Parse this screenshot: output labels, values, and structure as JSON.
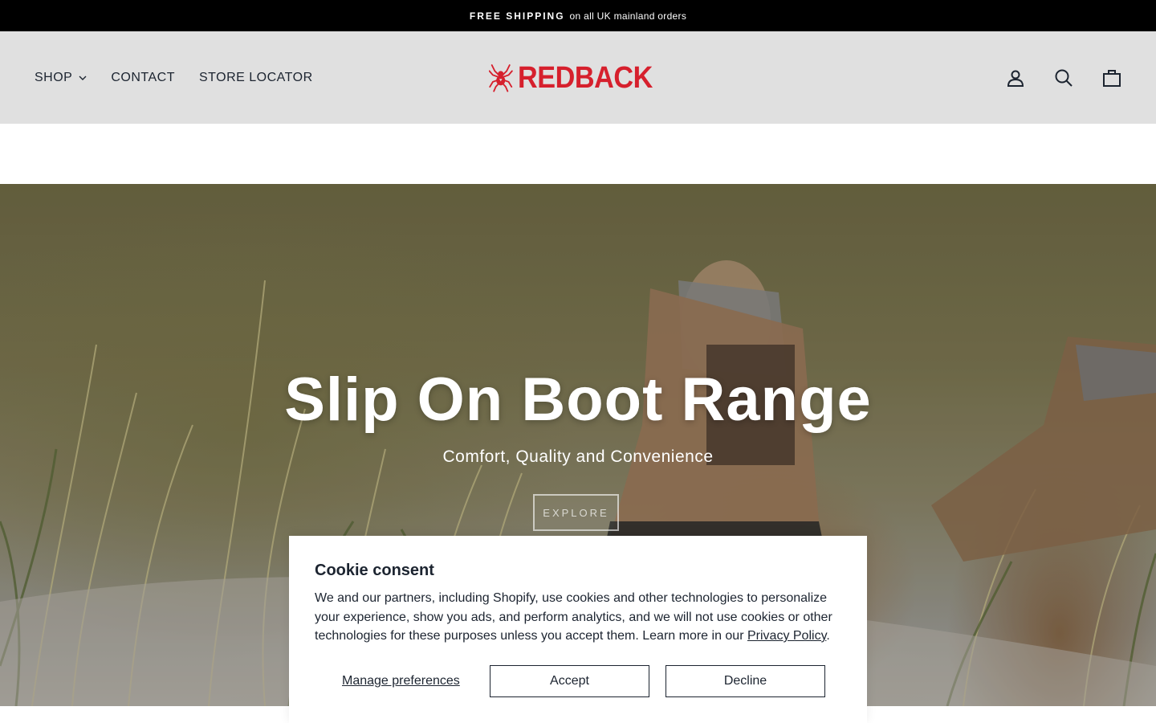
{
  "announcement": {
    "strong": "FREE SHIPPING",
    "text": "on all UK mainland orders"
  },
  "nav": {
    "items": [
      {
        "label": "SHOP",
        "has_dropdown": true
      },
      {
        "label": "CONTACT"
      },
      {
        "label": "STORE LOCATOR"
      }
    ]
  },
  "brand": {
    "name": "REDBACK",
    "color": "#d6202d"
  },
  "header_icons": [
    "account-icon",
    "search-icon",
    "cart-icon"
  ],
  "hero": {
    "title": "Slip On Boot Range",
    "subtitle": "Comfort, Quality and Convenience",
    "button": "EXPLORE"
  },
  "cookie": {
    "title": "Cookie consent",
    "text": "We and our partners, including Shopify, use cookies and other technologies to personalize your experience, show you ads, and perform analytics, and we will not use cookies or other technologies for these purposes unless you accept them. Learn more in our",
    "link": "Privacy Policy",
    "manage": "Manage preferences",
    "accept": "Accept",
    "decline": "Decline"
  }
}
